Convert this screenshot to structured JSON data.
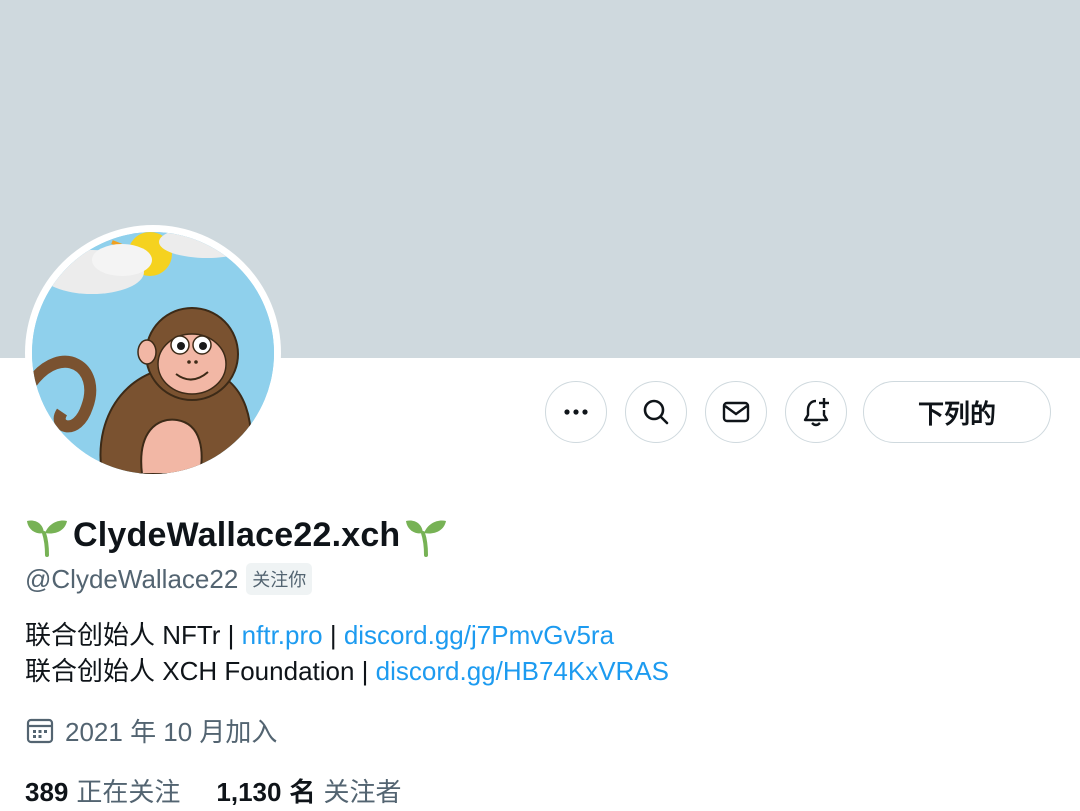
{
  "profile": {
    "display_name": "ClydeWallace22.xch",
    "handle": "@ClydeWallace22",
    "follows_you": "关注你"
  },
  "actions": {
    "more_icon": "more-horizontal-icon",
    "search_icon": "search-icon",
    "message_icon": "envelope-icon",
    "notify_icon": "bell-plus-icon",
    "follow_label": "下列的"
  },
  "bio": {
    "line1_prefix": "联合创始人 NFTr | ",
    "line1_link1": "nftr.pro",
    "line1_sep": " | ",
    "line1_link2": "discord.gg/j7PmvGv5ra",
    "line2_prefix": "联合创始人 XCH Foundation | ",
    "line2_link": "discord.gg/HB74KxVRAS"
  },
  "joined": {
    "icon": "calendar-icon",
    "text": "2021 年 10 月加入"
  },
  "stats": {
    "following_count": "389",
    "following_label": "正在关注",
    "followers_count": "1,130",
    "followers_unit": "名",
    "followers_label": "关注者"
  },
  "colors": {
    "banner": "#cfd9de",
    "link": "#1d9bf0",
    "secondary_text": "#536471",
    "sprout_green": "#77b255"
  }
}
